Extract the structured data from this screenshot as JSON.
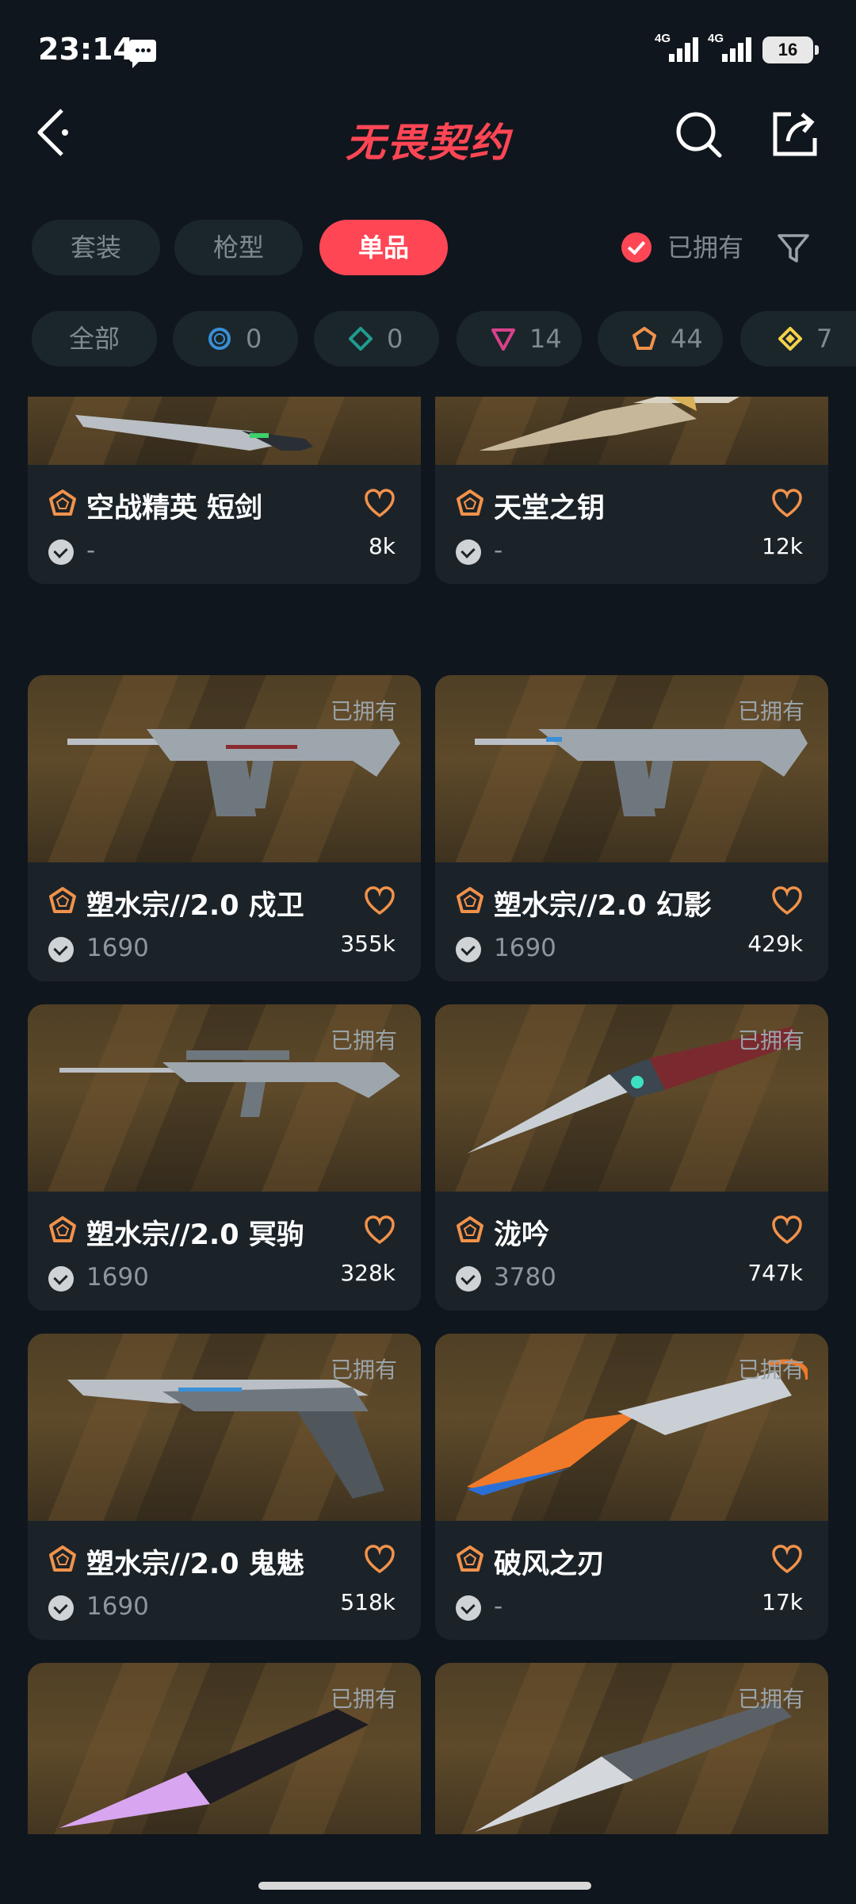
{
  "status_bar": {
    "time": "23:14",
    "signal_1": "4G",
    "signal_2": "4G",
    "battery": "16"
  },
  "header": {
    "title": "无畏契约"
  },
  "tabs": [
    {
      "label": "套装",
      "active": false
    },
    {
      "label": "枪型",
      "active": false
    },
    {
      "label": "单品",
      "active": true
    }
  ],
  "owned_filter": {
    "label": "已拥有",
    "checked": true
  },
  "tier_filters": [
    {
      "label": "全部"
    },
    {
      "tier": "select",
      "color": "#3a8fd6",
      "count": "0"
    },
    {
      "tier": "deluxe",
      "color": "#1f9c8f",
      "count": "0"
    },
    {
      "tier": "premium",
      "color": "#d8428a",
      "count": "14"
    },
    {
      "tier": "exclusive",
      "color": "#f2924a",
      "count": "44"
    },
    {
      "tier": "ultra",
      "color": "#f5d24a",
      "count": "7"
    }
  ],
  "colors": {
    "accent": "#ff4655",
    "background": "#10161d",
    "card": "#1b2329",
    "exclusive_tier": "#f2924a"
  },
  "items": [
    {
      "name": "空战精英 短剑",
      "price": "-",
      "likes": "8k",
      "owned_label": "",
      "weapon_icon": "knife-icon"
    },
    {
      "name": "天堂之钥",
      "price": "-",
      "likes": "12k",
      "owned_label": "",
      "weapon_icon": "knife-icon"
    },
    {
      "name": "塑水宗//2.0 戍卫",
      "price": "1690",
      "likes": "355k",
      "owned_label": "已拥有",
      "weapon_icon": "rifle-icon"
    },
    {
      "name": "塑水宗//2.0 幻影",
      "price": "1690",
      "likes": "429k",
      "owned_label": "已拥有",
      "weapon_icon": "rifle-icon"
    },
    {
      "name": "塑水宗//2.0 冥驹",
      "price": "1690",
      "likes": "328k",
      "owned_label": "已拥有",
      "weapon_icon": "sniper-icon"
    },
    {
      "name": "泷吟",
      "price": "3780",
      "likes": "747k",
      "owned_label": "已拥有",
      "weapon_icon": "knife-icon"
    },
    {
      "name": "塑水宗//2.0 鬼魅",
      "price": "1690",
      "likes": "518k",
      "owned_label": "已拥有",
      "weapon_icon": "pistol-icon"
    },
    {
      "name": "破风之刃",
      "price": "-",
      "likes": "17k",
      "owned_label": "已拥有",
      "weapon_icon": "knife-icon"
    },
    {
      "name": "",
      "price": "",
      "likes": "",
      "owned_label": "已拥有",
      "weapon_icon": "knife-icon"
    },
    {
      "name": "",
      "price": "",
      "likes": "",
      "owned_label": "已拥有",
      "weapon_icon": "knife-icon"
    }
  ]
}
